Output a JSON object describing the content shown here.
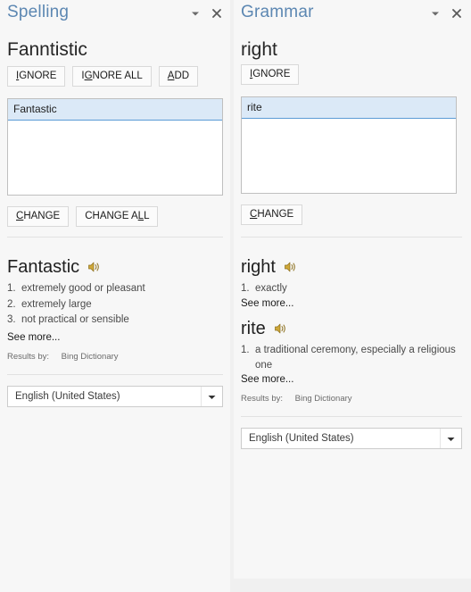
{
  "spelling": {
    "title": "Spelling",
    "controls": {
      "menu_icon": "chevron-down-icon",
      "close_icon": "close-icon"
    },
    "headword": "Fanntistic",
    "buttons": [
      {
        "label": "IGNORE",
        "accel": "I",
        "name": "ignore-button"
      },
      {
        "label": "IGNORE ALL",
        "accel": "G",
        "name": "ignore-all-button"
      },
      {
        "label": "ADD",
        "accel": "A",
        "name": "add-button"
      }
    ],
    "suggestions": [
      "Fantastic"
    ],
    "selected_suggestion": "Fantastic",
    "change_buttons": [
      {
        "label": "CHANGE",
        "accel": "C",
        "name": "change-button"
      },
      {
        "label": "CHANGE ALL",
        "accel": "L",
        "name": "change-all-button"
      }
    ],
    "definition": {
      "word": "Fantastic",
      "speaker_icon": "speaker-icon",
      "senses": [
        "extremely good or pleasant",
        "extremely large",
        "not practical or sensible"
      ],
      "see_more": "See more...",
      "results_by_label": "Results by:",
      "results_by_source": "Bing Dictionary"
    },
    "language": {
      "value": "English (United States)",
      "arrow_icon": "chevron-down-icon"
    }
  },
  "grammar": {
    "title": "Grammar",
    "controls": {
      "menu_icon": "chevron-down-icon",
      "close_icon": "close-icon"
    },
    "headword": "right",
    "buttons": [
      {
        "label": "IGNORE",
        "accel": "I",
        "name": "ignore-button"
      }
    ],
    "suggestions": [
      "rite"
    ],
    "selected_suggestion": "rite",
    "change_buttons": [
      {
        "label": "CHANGE",
        "accel": "C",
        "name": "change-button"
      }
    ],
    "definitions": [
      {
        "word": "right",
        "speaker_icon": "speaker-icon",
        "senses": [
          "exactly"
        ],
        "see_more": "See more..."
      },
      {
        "word": "rite",
        "speaker_icon": "speaker-icon",
        "senses": [
          "a traditional ceremony, especially a religious one"
        ],
        "see_more": "See more..."
      }
    ],
    "results_by_label": "Results by:",
    "results_by_source": "Bing Dictionary",
    "language": {
      "value": "English (United States)",
      "arrow_icon": "chevron-down-icon"
    }
  },
  "colors": {
    "panel_bg": "#f7f7f7",
    "page_bg": "#f0f0f0",
    "title_blue": "#5c87b2",
    "selection_blue": "#dbe9f7",
    "selection_border": "#5b9bd5",
    "speaker_gold": "#c9a227"
  }
}
